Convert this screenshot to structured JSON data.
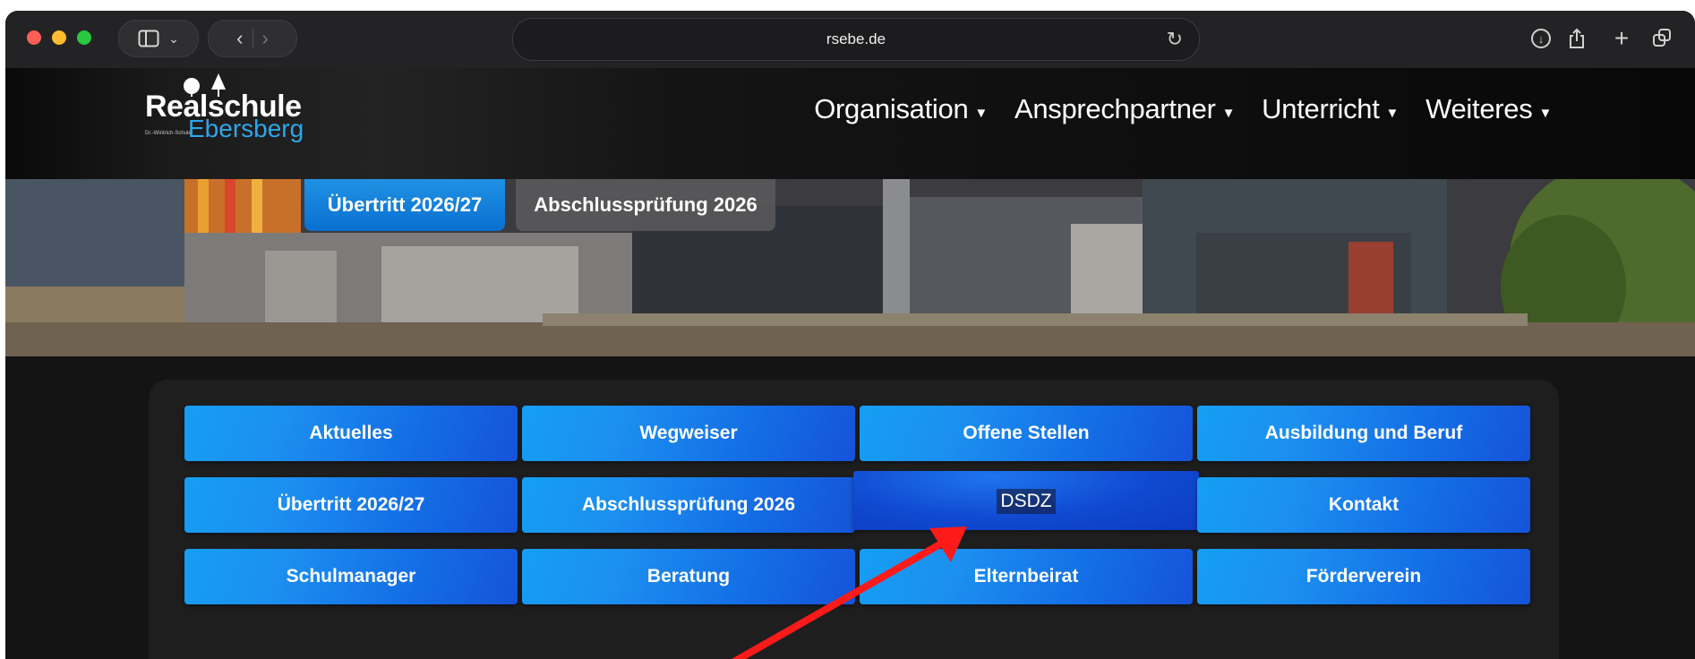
{
  "browser": {
    "url": "rsebe.de"
  },
  "site": {
    "logo": {
      "main": "Realschule",
      "sub": "Dr.-Wintrich-Schule",
      "city": "Ebersberg"
    },
    "nav": [
      {
        "label": "Organisation"
      },
      {
        "label": "Ansprechpartner"
      },
      {
        "label": "Unterricht"
      },
      {
        "label": "Weiteres"
      }
    ],
    "hero_buttons": [
      {
        "label": "Übertritt 2026/27"
      },
      {
        "label": "Abschlussprüfung 2026"
      }
    ],
    "tiles": [
      {
        "label": "Aktuelles"
      },
      {
        "label": "Wegweiser"
      },
      {
        "label": "Offene Stellen"
      },
      {
        "label": "Ausbildung und Beruf"
      },
      {
        "label": "Übertritt 2026/27"
      },
      {
        "label": "Abschlussprüfung 2026"
      },
      {
        "label": "DSDZ"
      },
      {
        "label": "Kontakt"
      },
      {
        "label": "Schulmanager"
      },
      {
        "label": "Beratung"
      },
      {
        "label": "Elternbeirat"
      },
      {
        "label": "Förderverein"
      }
    ]
  },
  "colors": {
    "accent": "#2ea6e8",
    "tile_blue": "#1c8ff0",
    "arrow": "#ff1a1a"
  }
}
